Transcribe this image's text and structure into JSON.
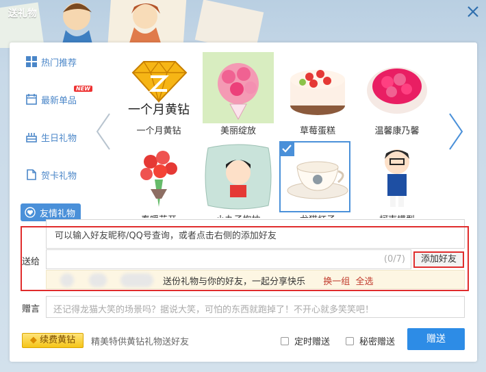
{
  "window": {
    "title": "送礼物"
  },
  "sidebar": {
    "items": [
      {
        "label": "热门推荐",
        "icon": "grid-icon"
      },
      {
        "label": "最新单品",
        "icon": "calendar-icon",
        "badge": "NEW"
      },
      {
        "label": "生日礼物",
        "icon": "cake-icon"
      },
      {
        "label": "贺卡礼物",
        "icon": "card-icon"
      },
      {
        "label": "友情礼物",
        "icon": "heart-icon"
      }
    ]
  },
  "gifts": {
    "row1": [
      {
        "label": "一个月黄钻",
        "pic_text": "一个月黄钻"
      },
      {
        "label": "美丽绽放"
      },
      {
        "label": "草莓蛋糕"
      },
      {
        "label": "温馨康乃馨"
      }
    ],
    "row2": [
      {
        "label": "春暖花开"
      },
      {
        "label": "小丸子抱枕"
      },
      {
        "label": "龙猫杯子"
      },
      {
        "label": "柯南模型"
      }
    ]
  },
  "send": {
    "label": "送给",
    "search_placeholder": "可以输入好友昵称/QQ号查询，或者点击右侧的添加好友",
    "counter": "(0/7)",
    "add_friend": "添加好友",
    "friends_text": "送份礼物与你的好友，一起分享快乐",
    "shuffle": "换一组",
    "select_all": "全选"
  },
  "note": {
    "label": "赠言",
    "placeholder": "还记得龙猫大笑的场景吗？据说大笑，可怕的东西就跑掉了！不开心就多笑笑吧！"
  },
  "footer": {
    "renew_button": "续费黄钻",
    "renew_text": "精美特供黄钻礼物送好友",
    "timed_send": "定时赠送",
    "secret_send": "秘密赠送",
    "give_button": "赠送"
  },
  "colors": {
    "accent": "#2d8ce6",
    "highlight_red": "#e02b2b",
    "link_red": "#c0392b",
    "sidebar_blue": "#4a86c8"
  }
}
